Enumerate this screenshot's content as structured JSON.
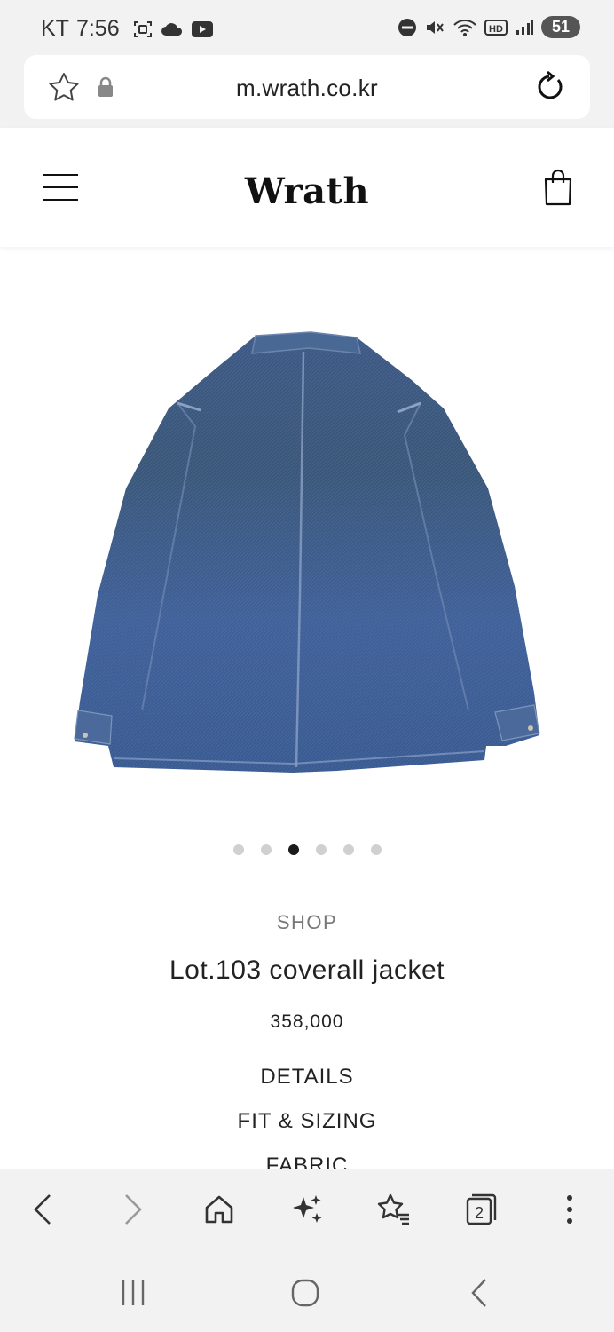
{
  "status_bar": {
    "carrier": "KT",
    "time": "7:56",
    "battery": "51"
  },
  "browser": {
    "url": "m.wrath.co.kr"
  },
  "site": {
    "logo": "Wrath"
  },
  "carousel": {
    "count": 6,
    "active_index": 2
  },
  "product": {
    "category": "SHOP",
    "name": "Lot.103 coverall jacket",
    "price": "358,000",
    "sections": [
      "DETAILS",
      "FIT & SIZING",
      "FABRIC"
    ]
  },
  "toolbar": {
    "tabs_count": "2"
  },
  "colors": {
    "chrome_bg": "#f2f2f2",
    "denim": "#3d5b8a",
    "active_dot": "#1a1a1a"
  }
}
